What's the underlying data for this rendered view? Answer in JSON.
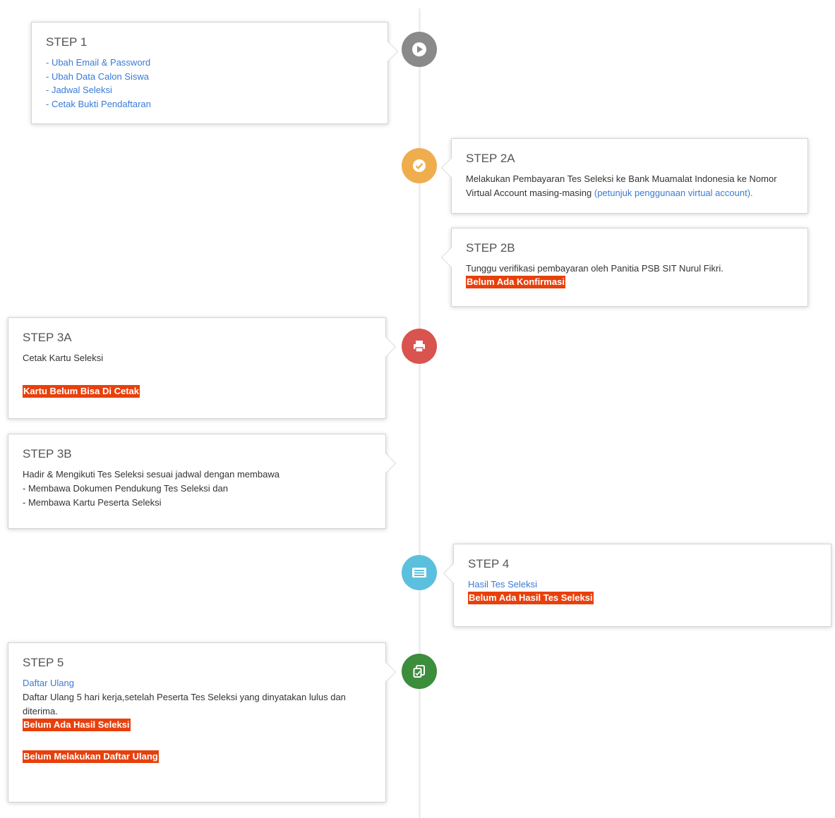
{
  "step1": {
    "title": "STEP 1",
    "links": [
      "- Ubah Email & Password",
      "- Ubah Data Calon Siswa",
      "- Jadwal Seleksi",
      "- Cetak Bukti Pendaftaran"
    ],
    "icon": "play-icon",
    "color": "#8a8a8a"
  },
  "step2a": {
    "title": "STEP 2A",
    "text": "Melakukan Pembayaran Tes Seleksi ke Bank Muamalat Indonesia ke Nomor Virtual Account masing-masing",
    "link": "(petunjuk penggunaan virtual account).",
    "icon": "check-icon",
    "color": "#f0ad4e"
  },
  "step2b": {
    "title": "STEP 2B",
    "text": "Tunggu verifikasi pembayaran oleh Panitia PSB SIT Nurul Fikri.",
    "status": "Belum Ada Konfirmasi"
  },
  "step3a": {
    "title": "STEP 3A",
    "text": "Cetak Kartu Seleksi",
    "status": "Kartu Belum Bisa Di Cetak",
    "icon": "printer-icon",
    "color": "#d9534f"
  },
  "step3b": {
    "title": "STEP 3B",
    "lines": [
      "Hadir & Mengikuti Tes Seleksi sesuai jadwal dengan membawa",
      "- Membawa Dokumen Pendukung Tes Seleksi dan",
      "- Membawa Kartu Peserta Seleksi"
    ]
  },
  "step4": {
    "title": "STEP 4",
    "link": "Hasil Tes Seleksi",
    "status": "Belum Ada Hasil Tes Seleksi",
    "icon": "list-icon",
    "color": "#5bc0de"
  },
  "step5": {
    "title": "STEP 5",
    "link": "Daftar Ulang",
    "text": "Daftar Ulang 5 hari kerja,setelah Peserta Tes Seleksi yang dinyatakan lulus dan diterima.",
    "status1": "Belum Ada Hasil Seleksi",
    "status2": "Belum Melakukan Daftar Ulang",
    "icon": "copy-icon",
    "color": "#3c8d3c"
  },
  "colors": {
    "link": "#3a7bd5",
    "status_bg": "#e8400c",
    "line": "#eeeeee"
  }
}
